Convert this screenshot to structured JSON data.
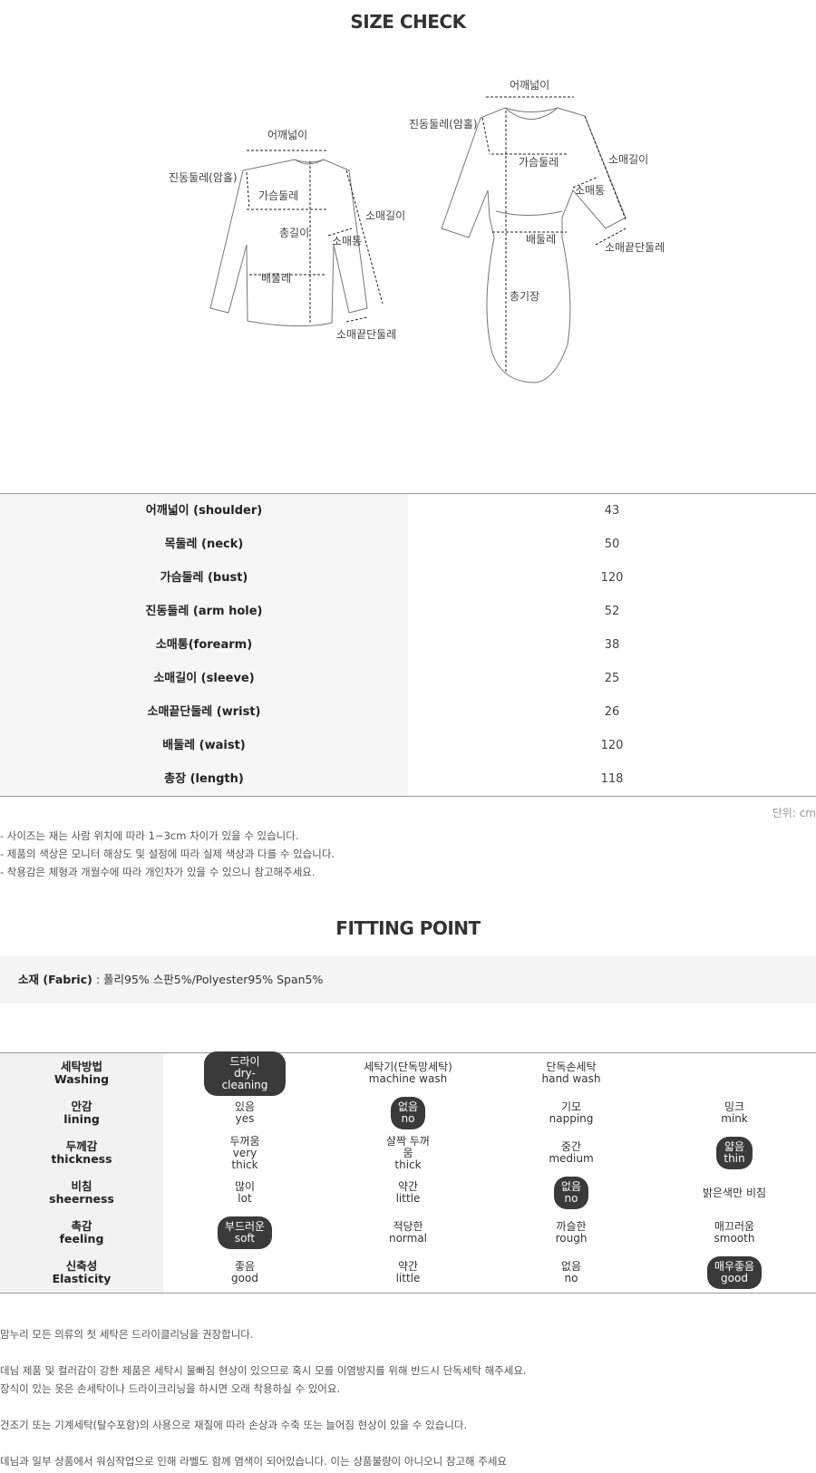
{
  "size_check": {
    "title": "SIZE CHECK",
    "diagram": {
      "top_labels": [
        "어깨넓이",
        "진동둘레(암홀)",
        "가슴둘레",
        "총길이",
        "소매통",
        "소매길이",
        "배둘레",
        "소매끝단둘레"
      ],
      "dress_labels": [
        "어깨넓이",
        "진동둘레(암홀)",
        "가슴둘레",
        "소매길이",
        "소매통",
        "소매끝단둘레",
        "배둘레",
        "총기장"
      ]
    },
    "rows": [
      {
        "label": "어깨넓이 (shoulder)",
        "value": "43"
      },
      {
        "label": "목둘레 (neck)",
        "value": "50"
      },
      {
        "label": "가슴둘레 (bust)",
        "value": "120"
      },
      {
        "label": "진동둘레 (arm hole)",
        "value": "52"
      },
      {
        "label": "소매통(forearm)",
        "value": "38"
      },
      {
        "label": "소매길이 (sleeve)",
        "value": "25"
      },
      {
        "label": "소매끝단둘레 (wrist)",
        "value": "26"
      },
      {
        "label": "배둘레 (waist)",
        "value": "120"
      },
      {
        "label": "총장 (length)",
        "value": "118"
      }
    ],
    "unit": "단위: cm",
    "notes": [
      "- 사이즈는 재는 사람 위치에 따라 1~3cm 차이가 있을 수 있습니다.",
      "- 제품의 색상은 모니터 해상도 및 설정에 따라 실제 색상과 다를 수 있습니다.",
      "- 착용감은 체형과 개월수에 따라 개인차가 있을 수 있으니 참고해주세요."
    ]
  },
  "fitting_point": {
    "title": "FITTING POINT",
    "fabric_label": "소재 (Fabric)",
    "fabric_value": ": 폴리95% 스판5%/Polyester95% Span5%",
    "rows": [
      {
        "ko": "세탁방법",
        "en": "Washing",
        "options": [
          {
            "ko": "드라이",
            "en": "dry-cleaning",
            "selected": true
          },
          {
            "ko": "세탁기(단독망세탁)",
            "en": "machine wash",
            "selected": false
          },
          {
            "ko": "단독손세탁",
            "en": "hand wash",
            "selected": false
          },
          {
            "ko": "",
            "en": "",
            "selected": false
          }
        ]
      },
      {
        "ko": "안감",
        "en": "lining",
        "options": [
          {
            "ko": "있음",
            "en": "yes",
            "selected": false
          },
          {
            "ko": "없음",
            "en": "no",
            "selected": true
          },
          {
            "ko": "기모",
            "en": "napping",
            "selected": false
          },
          {
            "ko": "밍크",
            "en": "mink",
            "selected": false
          }
        ]
      },
      {
        "ko": "두께감",
        "en": "thickness",
        "options": [
          {
            "ko": "두꺼움",
            "en": "very thick",
            "selected": false
          },
          {
            "ko": "살짝 두꺼움",
            "en": "thick",
            "selected": false
          },
          {
            "ko": "중간",
            "en": "medium",
            "selected": false
          },
          {
            "ko": "얇음",
            "en": "thin",
            "selected": true
          }
        ]
      },
      {
        "ko": "비침",
        "en": "sheerness",
        "options": [
          {
            "ko": "많이",
            "en": "lot",
            "selected": false
          },
          {
            "ko": "약간",
            "en": "little",
            "selected": false
          },
          {
            "ko": "없음",
            "en": "no",
            "selected": true
          },
          {
            "ko": "밝은색만 비침",
            "en": "",
            "selected": false
          }
        ]
      },
      {
        "ko": "촉감",
        "en": "feeling",
        "options": [
          {
            "ko": "부드러운",
            "en": "soft",
            "selected": true
          },
          {
            "ko": "적당한",
            "en": "normal",
            "selected": false
          },
          {
            "ko": "까슬한",
            "en": "rough",
            "selected": false
          },
          {
            "ko": "매끄러움",
            "en": "smooth",
            "selected": false
          }
        ]
      },
      {
        "ko": "신축성",
        "en": "Elasticity",
        "options": [
          {
            "ko": "좋음",
            "en": "good",
            "selected": false
          },
          {
            "ko": "약간",
            "en": "little",
            "selected": false
          },
          {
            "ko": "없음",
            "en": "no",
            "selected": false
          },
          {
            "ko": "매우좋음",
            "en": "good",
            "selected": true
          }
        ]
      }
    ],
    "footer_notes": [
      "맘누리 모든 의류의 첫 세탁은 드라이클리닝을 권장합니다.",
      "데님 제품 및 컬러감이 강한 제품은 세탁시 물빠짐 현상이 있으므로 혹시 모를 이염방지를 위해 반드시 단독세탁 해주세요.",
      "장식이 있는 옷은 손세탁이나 드라이크리닝을 하시면 오래 착용하실 수 있어요.",
      "건조기 또는 기계세탁(탈수포함)의 사용으로 재질에 따라 손상과 수축 또는 늘어짐 현상이 있을 수 있습니다.",
      "데님과 일부 상품에서 워싱작업으로 인해 라벨도 함께 염색이 되어있습니다. 이는 상품불량이 아니오니 참고해 주세요"
    ]
  }
}
